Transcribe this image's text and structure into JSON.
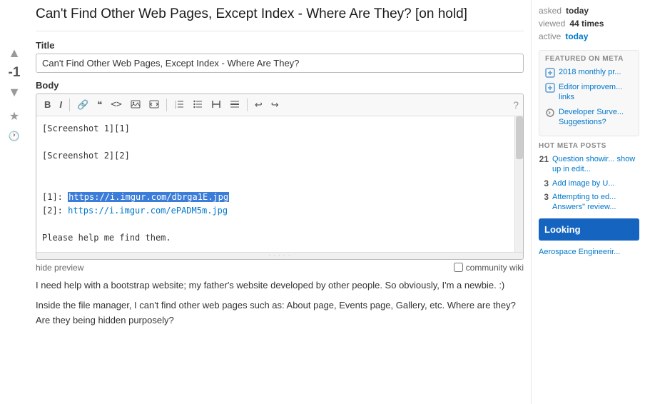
{
  "page": {
    "title": "Can't Find Other Web Pages, Except Index - Where Are They? [on hold]"
  },
  "meta_stats": {
    "asked_label": "asked",
    "asked_val": "today",
    "viewed_label": "viewed",
    "viewed_val": "44 times",
    "active_label": "active",
    "active_val": "today"
  },
  "form": {
    "title_label": "Title",
    "title_value": "Can't Find Other Web Pages, Except Index - Where Are They?",
    "body_label": "Body",
    "hide_preview": "hide preview",
    "community_wiki": "community wiki"
  },
  "toolbar": {
    "bold": "B",
    "italic": "I",
    "link": "🔗",
    "blockquote": "❝",
    "code": "<>",
    "image": "🖼",
    "preformatted": "{}",
    "ordered_list": "1.",
    "unordered_list": "•",
    "heading": "H",
    "horizontal_rule": "—",
    "undo": "↩",
    "redo": "↪",
    "help": "?"
  },
  "editor_content": {
    "line1": "[Screenshot 1][1]",
    "line2": "",
    "line3": "[Screenshot 2][2]",
    "line4": "",
    "line5": "",
    "ref1": "[1]: https://i.imgur.com/dbrga1E.jpg",
    "ref2": "[2]: https://i.imgur.com/ePADM5m.jpg",
    "line6": "",
    "line7": "Please help me find them.",
    "url1": "https://i.imgur.com/dbrga1E.jpg",
    "url2": "https://i.imgur.com/ePADM5m.jpg"
  },
  "preview": {
    "p1": "I need help with a bootstrap website; my father's website developed by other people. So obviously, I'm a newbie. :)",
    "p2": "Inside the file manager, I can't find other web pages such as: About page, Events page, Gallery, etc. Where are they? Are they being hidden purposely?"
  },
  "featured_meta": {
    "title": "FEATURED ON META",
    "items": [
      {
        "text": "2018 monthly pr..."
      },
      {
        "text": "Editor improvem... links"
      },
      {
        "text": "Developer Surve... Suggestions?"
      }
    ]
  },
  "hot_meta": {
    "title": "HOT META POSTS",
    "items": [
      {
        "count": "21",
        "text": "Question showir... show up in edit..."
      },
      {
        "count": "3",
        "text": "Add image by U..."
      },
      {
        "count": "3",
        "text": "Attempting to ed... Answers\" review..."
      }
    ]
  },
  "looking": {
    "title": "Looking",
    "sub": "Aerospace Engineerir..."
  }
}
